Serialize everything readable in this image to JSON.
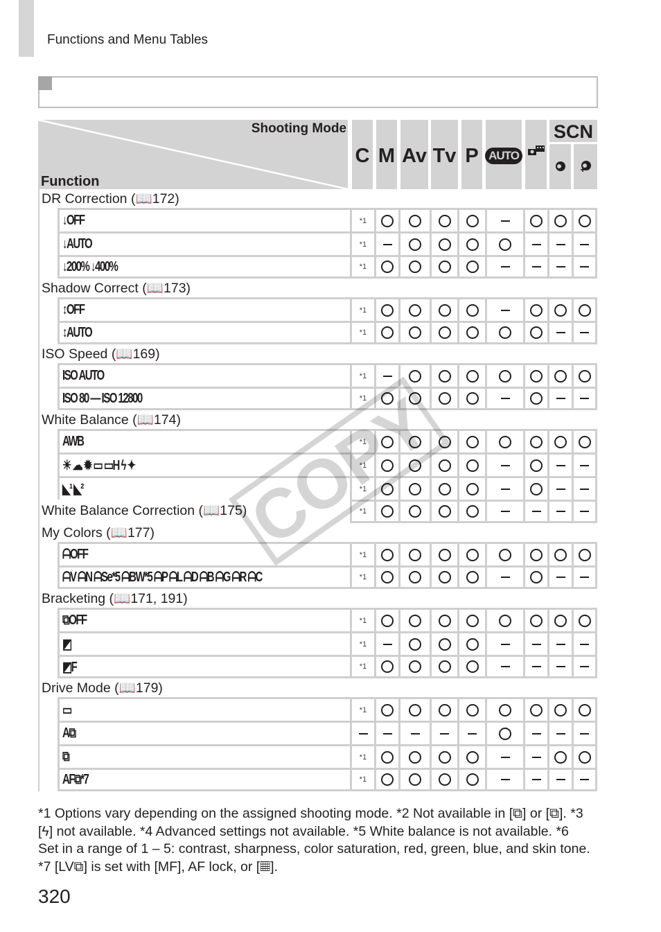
{
  "page": {
    "header": "Functions and Menu Tables",
    "page_number": "320"
  },
  "table": {
    "header_top": "Shooting Mode",
    "header_left": "Function",
    "modes": [
      {
        "label": "C"
      },
      {
        "label": "M"
      },
      {
        "label": "Av"
      },
      {
        "label": "Tv"
      },
      {
        "label": "P"
      },
      {
        "label": "AUTO",
        "badge": true
      },
      {
        "label": "hybrid-auto-icon",
        "icon": "movie-digest-icon"
      },
      {
        "label": "SCN",
        "sub": [
          "portrait-icon",
          "smooth-skin-icon"
        ]
      }
    ],
    "scn_label": "SCN",
    "rows": [
      {
        "type": "group",
        "label": "DR Correction (📖172)"
      },
      {
        "type": "data",
        "icon": "dr-off-icon",
        "glyph": "↓OFF",
        "note": "*1",
        "values": [
          "O",
          "O",
          "O",
          "O",
          "–",
          "O",
          "O",
          "O"
        ]
      },
      {
        "type": "data",
        "icon": "dr-auto-icon",
        "glyph": "↓AUTO",
        "note": "*1",
        "values": [
          "–",
          "O",
          "O",
          "O",
          "O",
          "–",
          "–",
          "–"
        ]
      },
      {
        "type": "data",
        "icon": "dr-200-400-icon",
        "glyph": "↓200%  ↓400%",
        "note": "*1",
        "values": [
          "O",
          "O",
          "O",
          "O",
          "–",
          "–",
          "–",
          "–"
        ]
      },
      {
        "type": "group",
        "label": "Shadow Correct (📖173)"
      },
      {
        "type": "data",
        "icon": "shadow-off-icon",
        "glyph": "↕OFF",
        "note": "*1",
        "values": [
          "O",
          "O",
          "O",
          "O",
          "–",
          "O",
          "O",
          "O"
        ]
      },
      {
        "type": "data",
        "icon": "shadow-auto-icon",
        "glyph": "↕AUTO",
        "note": "*1",
        "values": [
          "O",
          "O",
          "O",
          "O",
          "O",
          "O",
          "–",
          "–"
        ]
      },
      {
        "type": "group",
        "label": "ISO Speed (📖169)"
      },
      {
        "type": "data",
        "icon": "iso-auto-icon",
        "glyph": "ISO AUTO",
        "note": "*1",
        "values": [
          "–",
          "O",
          "O",
          "O",
          "O",
          "O",
          "O",
          "O"
        ]
      },
      {
        "type": "data",
        "icon": "iso-80-12800-icon",
        "glyph": "ISO 80 — ISO 12800",
        "note": "*1",
        "values": [
          "O",
          "O",
          "O",
          "O",
          "–",
          "O",
          "–",
          "–"
        ]
      },
      {
        "type": "group",
        "label": "White Balance (📖174)"
      },
      {
        "type": "data",
        "icon": "awb-icon",
        "glyph": "AWB",
        "note": "*1",
        "values": [
          "O",
          "O",
          "O",
          "O",
          "O",
          "O",
          "O",
          "O"
        ]
      },
      {
        "type": "data",
        "icon": "wb-presets-icon",
        "glyph": "☀ ☁ ✹ ▭ ▭H ϟ ✦",
        "note": "*1",
        "values": [
          "O",
          "O",
          "O",
          "O",
          "–",
          "O",
          "–",
          "–"
        ]
      },
      {
        "type": "data",
        "icon": "wb-custom-icon",
        "glyph": "◣¹ ◣²",
        "note": "*1",
        "values": [
          "O",
          "O",
          "O",
          "O",
          "–",
          "O",
          "–",
          "–"
        ]
      },
      {
        "type": "single",
        "label": "White Balance Correction (📖175)",
        "note": "*1",
        "values": [
          "O",
          "O",
          "O",
          "O",
          "–",
          "–",
          "–",
          "–"
        ]
      },
      {
        "type": "group",
        "label": "My Colors (📖177)"
      },
      {
        "type": "data",
        "icon": "my-colors-off-icon",
        "glyph": "ᗩOFF",
        "note": "*1",
        "values": [
          "O",
          "O",
          "O",
          "O",
          "O",
          "O",
          "O",
          "O"
        ]
      },
      {
        "type": "data",
        "icon": "my-colors-modes-icon",
        "glyph": "ᗩV ᗩN ᗩSe*5 ᗩBW*5 ᗩP ᗩL ᗩD ᗩB ᗩG ᗩR ᗩC",
        "note": "*1",
        "values": [
          "O",
          "O",
          "O",
          "O",
          "–",
          "O",
          "–",
          "–"
        ]
      },
      {
        "type": "group",
        "label": "Bracketing (📖171, 191)"
      },
      {
        "type": "data",
        "icon": "bracketing-off-icon",
        "glyph": "⧉OFF",
        "note": "*1",
        "values": [
          "O",
          "O",
          "O",
          "O",
          "O",
          "O",
          "O",
          "O"
        ]
      },
      {
        "type": "data",
        "icon": "ae-bracketing-icon",
        "glyph": "◩",
        "note": "*1",
        "values": [
          "–",
          "O",
          "O",
          "O",
          "–",
          "–",
          "–",
          "–"
        ]
      },
      {
        "type": "data",
        "icon": "focus-bracketing-icon",
        "glyph": "◩F",
        "note": "*1",
        "values": [
          "O",
          "O",
          "O",
          "O",
          "–",
          "–",
          "–",
          "–"
        ]
      },
      {
        "type": "group",
        "label": "Drive Mode (📖179)"
      },
      {
        "type": "data",
        "icon": "single-shot-icon",
        "glyph": "▭",
        "note": "*1",
        "values": [
          "O",
          "O",
          "O",
          "O",
          "O",
          "O",
          "O",
          "O"
        ]
      },
      {
        "type": "data",
        "icon": "auto-continuous-icon",
        "glyph": "A⧉",
        "note": "–",
        "values": [
          "–",
          "–",
          "–",
          "–",
          "O",
          "–",
          "–",
          "–"
        ]
      },
      {
        "type": "data",
        "icon": "continuous-icon",
        "glyph": "⧉",
        "note": "*1",
        "values": [
          "O",
          "O",
          "O",
          "O",
          "–",
          "–",
          "O",
          "O"
        ]
      },
      {
        "type": "data",
        "icon": "af-continuous-icon",
        "glyph": "AF⧉*7",
        "note": "*1",
        "values": [
          "O",
          "O",
          "O",
          "O",
          "–",
          "–",
          "–",
          "–"
        ]
      }
    ]
  },
  "footnotes": "*1 Options vary depending on the assigned shooting mode.  *2 Not available in [⧉] or [⧉].  *3 [ϟ] not available.  *4 Advanced settings not available.  *5 White balance is not available.  *6 Set in a range of 1 – 5: contrast, sharpness, color saturation, red, green, blue, and skin tone.  *7 [LV⧉] is set with [MF], AF lock, or [▦].",
  "watermark": "COPY",
  "colors": {
    "header_gray": "#d3d3d3",
    "border_gray": "#cfcfcf",
    "text": "#231f20"
  }
}
